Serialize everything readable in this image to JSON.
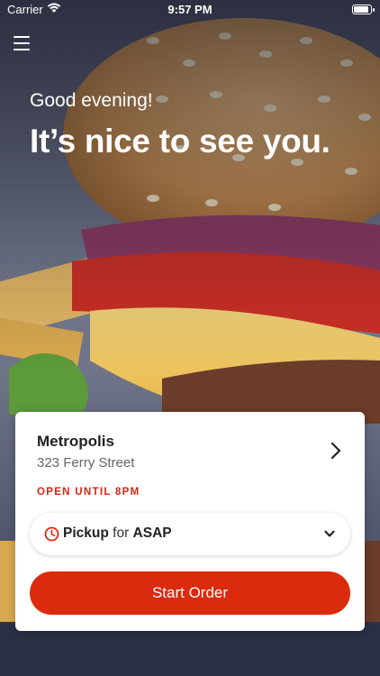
{
  "status_bar": {
    "carrier": "Carrier",
    "time": "9:57 PM"
  },
  "hero": {
    "greeting": "Good evening!",
    "headline": "It’s nice to see you."
  },
  "store": {
    "name": "Metropolis",
    "address": "323 Ferry Street",
    "status": "OPEN UNTIL 8PM"
  },
  "order_mode": {
    "mode": "Pickup",
    "connector": "for",
    "time": "ASAP"
  },
  "actions": {
    "start_order": "Start Order"
  },
  "colors": {
    "accent": "#dc2a0e",
    "status_red": "#d6270f"
  },
  "icons": [
    "menu-icon",
    "chevron-right-icon",
    "clock-icon",
    "chevron-down-icon",
    "wifi-icon",
    "battery-icon"
  ]
}
